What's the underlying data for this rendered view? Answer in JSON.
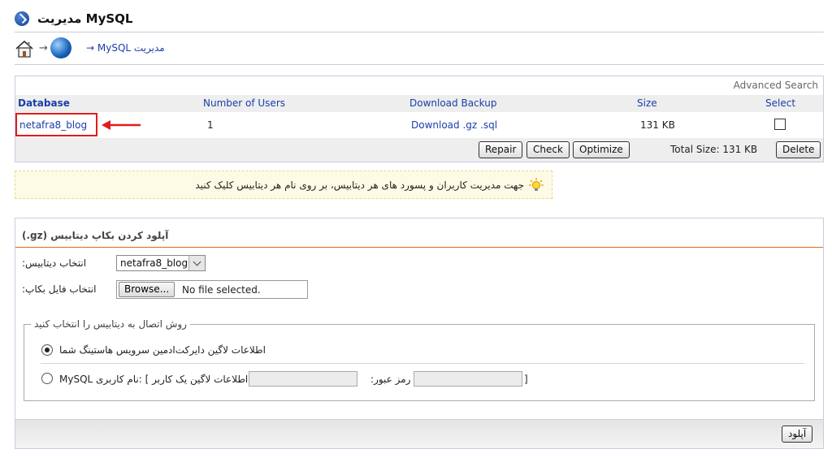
{
  "header": {
    "title": "مدیریت MySQL"
  },
  "breadcrumb": {
    "current": "→ MySQL مدیریت",
    "separator": "→"
  },
  "databases": {
    "advanced_search": "Advanced Search",
    "columns": {
      "database": "Database",
      "users": "Number of Users",
      "backup": "Download Backup",
      "size": "Size",
      "select": "Select"
    },
    "rows": [
      {
        "name": "netafra8_blog",
        "users": "1",
        "backup": "Download .gz .sql",
        "size": "131 KB"
      }
    ],
    "buttons": {
      "repair": "Repair",
      "check": "Check",
      "optimize": "Optimize",
      "delete": "Delete"
    },
    "total_size": "Total Size: 131 KB",
    "highlight_color": "#e21b1b"
  },
  "info": {
    "text": "جهت مدیریت کاربران و پسورد های هر دیتابیس، بر روی نام هر دیتابیس کلیک کنید"
  },
  "upload": {
    "title": "(.gz) آپلود کردن بکاپ دیتابیس",
    "select_db_label": ":انتخاب دیتابیس",
    "selected_db": "netafra8_blog",
    "file_label": ":انتخاب فایل بکاپ",
    "browse_label": "Browse...",
    "file_status": "No file selected.",
    "connection_legend": "روش اتصال به دیتابیس را انتخاب کنید",
    "option_direct": "اطلاعات لاگین دایرکت‌ادمین سرویس هاستینگ شما",
    "option_mysql": "MySQL اطلاعات لاگین یک کاربر ] :نام کاربری",
    "password_label": ":رمز عبور",
    "bracket_close": "]",
    "submit_label": "آپلود"
  },
  "colors": {
    "link": "#1a3ea8",
    "accent_line": "#e06b1a",
    "info_bg": "#fdfbe6"
  }
}
